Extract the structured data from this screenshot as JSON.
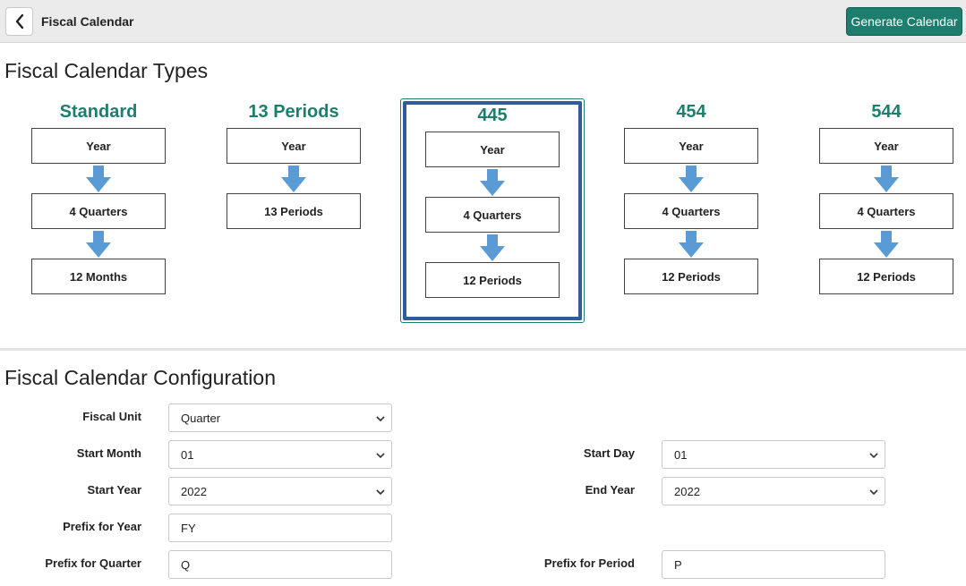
{
  "header": {
    "title": "Fiscal Calendar",
    "generate_label": "Generate Calendar"
  },
  "types_section": {
    "title": "Fiscal Calendar Types",
    "selected": "445",
    "types": [
      {
        "name": "Standard",
        "levels": [
          "Year",
          "4 Quarters",
          "12 Months"
        ]
      },
      {
        "name": "13 Periods",
        "levels": [
          "Year",
          "13 Periods"
        ]
      },
      {
        "name": "445",
        "levels": [
          "Year",
          "4 Quarters",
          "12 Periods"
        ]
      },
      {
        "name": "454",
        "levels": [
          "Year",
          "4 Quarters",
          "12 Periods"
        ]
      },
      {
        "name": "544",
        "levels": [
          "Year",
          "4 Quarters",
          "12 Periods"
        ]
      }
    ]
  },
  "config_section": {
    "title": "Fiscal Calendar Configuration",
    "fiscal_unit": {
      "label": "Fiscal Unit",
      "value": "Quarter"
    },
    "start_month": {
      "label": "Start Month",
      "value": "01"
    },
    "start_day": {
      "label": "Start Day",
      "value": "01"
    },
    "start_year": {
      "label": "Start Year",
      "value": "2022"
    },
    "end_year": {
      "label": "End Year",
      "value": "2022"
    },
    "prefix_year": {
      "label": "Prefix for Year",
      "value": "FY"
    },
    "prefix_quarter": {
      "label": "Prefix for Quarter",
      "value": "Q"
    },
    "prefix_period": {
      "label": "Prefix for Period",
      "value": "P"
    }
  },
  "colors": {
    "accent": "#1d7e6e",
    "arrow": "#5b9bd5",
    "selected_border": "#2f5d9a"
  }
}
